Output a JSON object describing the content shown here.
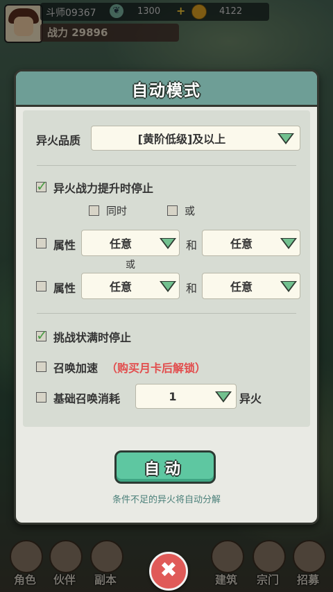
{
  "hud": {
    "player_name": "斗师09367",
    "resource1_value": "1300",
    "resource2_value": "4122",
    "power_text": "战力 29896",
    "resource1_icon": "leaf-icon",
    "resource2_icon": "coin-icon"
  },
  "dialog": {
    "title": "自动模式",
    "quality_label": "异火品质",
    "quality_value": "[黄阶低级]及以上",
    "stop_on_power_up": {
      "label": "异火战力提升时停止",
      "checked": true
    },
    "simultaneous": {
      "label": "同时",
      "checked": false
    },
    "or_option": {
      "label": "或",
      "checked": false
    },
    "attr_row1": {
      "label": "属性",
      "left": "任意",
      "connector": "和",
      "right": "任意",
      "checked": false
    },
    "between_rows": "或",
    "attr_row2": {
      "label": "属性",
      "left": "任意",
      "connector": "和",
      "right": "任意",
      "checked": false
    },
    "stop_on_full": {
      "label": "挑战状满时停止",
      "checked": true
    },
    "summon_speed": {
      "label": "召唤加速",
      "note": "（购买月卡后解锁）",
      "checked": false
    },
    "base_cost": {
      "label": "基础召唤消耗",
      "value": "1",
      "unit": "异火",
      "checked": false
    },
    "auto_button": "自动",
    "hint": "条件不足的异火将自动分解"
  },
  "bottom_nav": [
    {
      "label": "角色",
      "icon": "character-icon"
    },
    {
      "label": "伙伴",
      "icon": "partner-icon"
    },
    {
      "label": "副本",
      "icon": "dungeon-icon"
    },
    {
      "label": "建筑",
      "icon": "building-icon"
    },
    {
      "label": "宗门",
      "icon": "sect-icon"
    },
    {
      "label": "招募",
      "icon": "recruit-icon"
    }
  ],
  "close_symbol": "✖",
  "colors": {
    "header_teal": "#6e9e96",
    "button_green": "#5ec7a1",
    "warning_red": "#e24d4d",
    "check_green": "#4a9d45"
  }
}
